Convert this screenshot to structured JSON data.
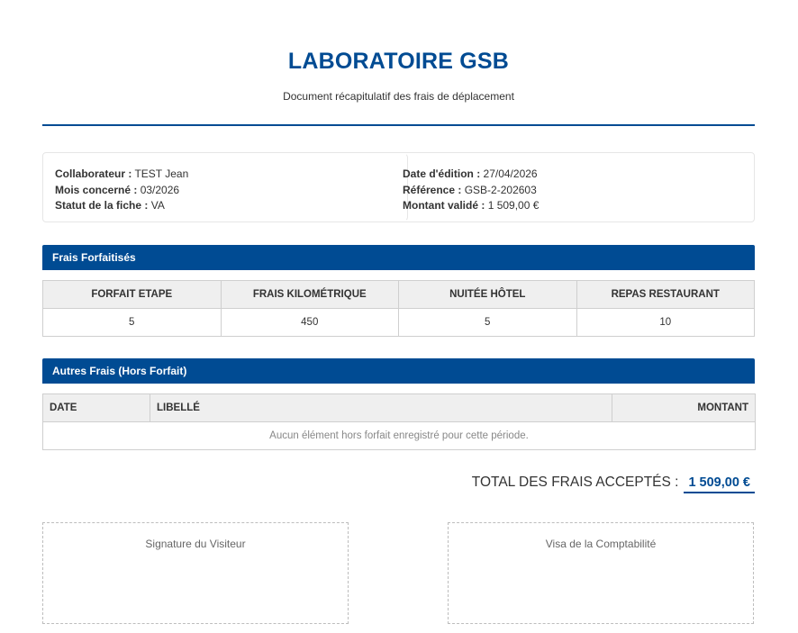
{
  "header": {
    "title": "LABORATOIRE GSB",
    "subtitle": "Document récapitulatif des frais de déplacement"
  },
  "info": {
    "left": [
      {
        "label": "Collaborateur :",
        "value": "TEST Jean"
      },
      {
        "label": "Mois concerné :",
        "value": "03/2026"
      },
      {
        "label": "Statut de la fiche :",
        "value": "VA"
      }
    ],
    "right": [
      {
        "label": "Date d'édition :",
        "value": "27/04/2026"
      },
      {
        "label": "Référence :",
        "value": "GSB-2-202603"
      },
      {
        "label": "Montant validé :",
        "value": "1 509,00 €"
      }
    ]
  },
  "frais_forfaitises": {
    "title": "Frais Forfaitisés",
    "columns": [
      "FORFAIT ETAPE",
      "FRAIS KILOMÉTRIQUE",
      "NUITÉE HÔTEL",
      "REPAS RESTAURANT"
    ],
    "values": [
      "5",
      "450",
      "5",
      "10"
    ]
  },
  "hors_forfait": {
    "title": "Autres Frais (Hors Forfait)",
    "columns": [
      "DATE",
      "LIBELLÉ",
      "MONTANT"
    ],
    "empty_message": "Aucun élément hors forfait enregistré pour cette période."
  },
  "total": {
    "label": "TOTAL DES FRAIS ACCEPTÉS :",
    "value": "1 509,00 €"
  },
  "signatures": {
    "visitor": "Signature du Visiteur",
    "accounting": "Visa de la Comptabilité"
  },
  "colors": {
    "brand": "#004b93",
    "header_bg": "#efefef",
    "border": "#cfcfcf"
  }
}
